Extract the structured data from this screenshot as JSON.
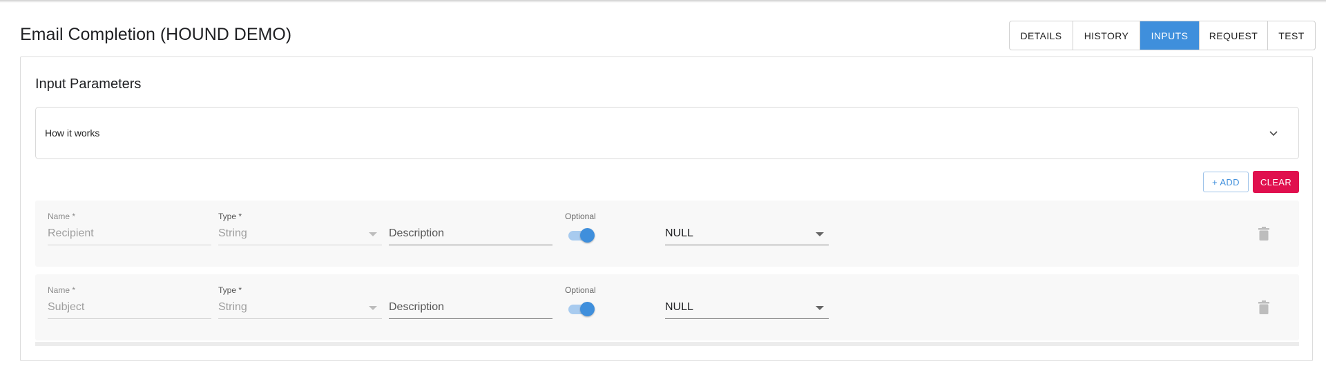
{
  "header": {
    "title": "Email Completion (HOUND DEMO)",
    "tabs": [
      {
        "label": "DETAILS",
        "active": false
      },
      {
        "label": "HISTORY",
        "active": false
      },
      {
        "label": "INPUTS",
        "active": true
      },
      {
        "label": "REQUEST",
        "active": false
      },
      {
        "label": "TEST",
        "active": false
      }
    ]
  },
  "main": {
    "section_title": "Input Parameters",
    "how_it_works": {
      "label": "How it works",
      "icon": "chevron-down-icon"
    },
    "add_label": "+ ADD",
    "clear_label": "CLEAR",
    "params": [
      {
        "name_label": "Name *",
        "name_value": "Recipient",
        "type_label": "Type *",
        "type_value": "String",
        "description_placeholder": "Description",
        "optional_label": "Optional",
        "optional": true,
        "default_value": "NULL",
        "delete_icon": "trash-icon"
      },
      {
        "name_label": "Name *",
        "name_value": "Subject",
        "type_label": "Type *",
        "type_value": "String",
        "description_placeholder": "Description",
        "optional_label": "Optional",
        "optional": true,
        "default_value": "NULL",
        "delete_icon": "trash-icon"
      }
    ]
  },
  "colors": {
    "accent": "#3f8fdc",
    "danger": "#e0104e"
  }
}
